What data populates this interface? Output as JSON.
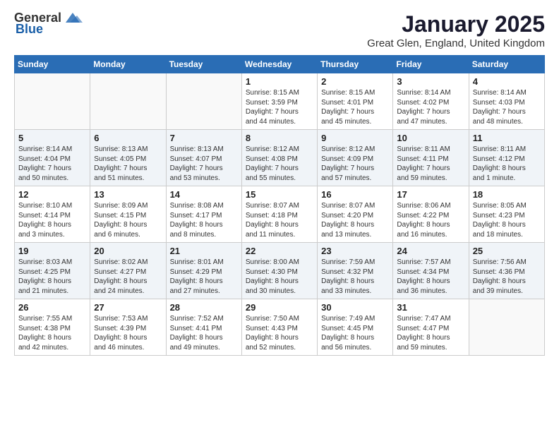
{
  "header": {
    "logo_general": "General",
    "logo_blue": "Blue",
    "title": "January 2025",
    "subtitle": "Great Glen, England, United Kingdom"
  },
  "weekdays": [
    "Sunday",
    "Monday",
    "Tuesday",
    "Wednesday",
    "Thursday",
    "Friday",
    "Saturday"
  ],
  "weeks": [
    [
      {
        "day": "",
        "info": ""
      },
      {
        "day": "",
        "info": ""
      },
      {
        "day": "",
        "info": ""
      },
      {
        "day": "1",
        "info": "Sunrise: 8:15 AM\nSunset: 3:59 PM\nDaylight: 7 hours\nand 44 minutes."
      },
      {
        "day": "2",
        "info": "Sunrise: 8:15 AM\nSunset: 4:01 PM\nDaylight: 7 hours\nand 45 minutes."
      },
      {
        "day": "3",
        "info": "Sunrise: 8:14 AM\nSunset: 4:02 PM\nDaylight: 7 hours\nand 47 minutes."
      },
      {
        "day": "4",
        "info": "Sunrise: 8:14 AM\nSunset: 4:03 PM\nDaylight: 7 hours\nand 48 minutes."
      }
    ],
    [
      {
        "day": "5",
        "info": "Sunrise: 8:14 AM\nSunset: 4:04 PM\nDaylight: 7 hours\nand 50 minutes."
      },
      {
        "day": "6",
        "info": "Sunrise: 8:13 AM\nSunset: 4:05 PM\nDaylight: 7 hours\nand 51 minutes."
      },
      {
        "day": "7",
        "info": "Sunrise: 8:13 AM\nSunset: 4:07 PM\nDaylight: 7 hours\nand 53 minutes."
      },
      {
        "day": "8",
        "info": "Sunrise: 8:12 AM\nSunset: 4:08 PM\nDaylight: 7 hours\nand 55 minutes."
      },
      {
        "day": "9",
        "info": "Sunrise: 8:12 AM\nSunset: 4:09 PM\nDaylight: 7 hours\nand 57 minutes."
      },
      {
        "day": "10",
        "info": "Sunrise: 8:11 AM\nSunset: 4:11 PM\nDaylight: 7 hours\nand 59 minutes."
      },
      {
        "day": "11",
        "info": "Sunrise: 8:11 AM\nSunset: 4:12 PM\nDaylight: 8 hours\nand 1 minute."
      }
    ],
    [
      {
        "day": "12",
        "info": "Sunrise: 8:10 AM\nSunset: 4:14 PM\nDaylight: 8 hours\nand 3 minutes."
      },
      {
        "day": "13",
        "info": "Sunrise: 8:09 AM\nSunset: 4:15 PM\nDaylight: 8 hours\nand 6 minutes."
      },
      {
        "day": "14",
        "info": "Sunrise: 8:08 AM\nSunset: 4:17 PM\nDaylight: 8 hours\nand 8 minutes."
      },
      {
        "day": "15",
        "info": "Sunrise: 8:07 AM\nSunset: 4:18 PM\nDaylight: 8 hours\nand 11 minutes."
      },
      {
        "day": "16",
        "info": "Sunrise: 8:07 AM\nSunset: 4:20 PM\nDaylight: 8 hours\nand 13 minutes."
      },
      {
        "day": "17",
        "info": "Sunrise: 8:06 AM\nSunset: 4:22 PM\nDaylight: 8 hours\nand 16 minutes."
      },
      {
        "day": "18",
        "info": "Sunrise: 8:05 AM\nSunset: 4:23 PM\nDaylight: 8 hours\nand 18 minutes."
      }
    ],
    [
      {
        "day": "19",
        "info": "Sunrise: 8:03 AM\nSunset: 4:25 PM\nDaylight: 8 hours\nand 21 minutes."
      },
      {
        "day": "20",
        "info": "Sunrise: 8:02 AM\nSunset: 4:27 PM\nDaylight: 8 hours\nand 24 minutes."
      },
      {
        "day": "21",
        "info": "Sunrise: 8:01 AM\nSunset: 4:29 PM\nDaylight: 8 hours\nand 27 minutes."
      },
      {
        "day": "22",
        "info": "Sunrise: 8:00 AM\nSunset: 4:30 PM\nDaylight: 8 hours\nand 30 minutes."
      },
      {
        "day": "23",
        "info": "Sunrise: 7:59 AM\nSunset: 4:32 PM\nDaylight: 8 hours\nand 33 minutes."
      },
      {
        "day": "24",
        "info": "Sunrise: 7:57 AM\nSunset: 4:34 PM\nDaylight: 8 hours\nand 36 minutes."
      },
      {
        "day": "25",
        "info": "Sunrise: 7:56 AM\nSunset: 4:36 PM\nDaylight: 8 hours\nand 39 minutes."
      }
    ],
    [
      {
        "day": "26",
        "info": "Sunrise: 7:55 AM\nSunset: 4:38 PM\nDaylight: 8 hours\nand 42 minutes."
      },
      {
        "day": "27",
        "info": "Sunrise: 7:53 AM\nSunset: 4:39 PM\nDaylight: 8 hours\nand 46 minutes."
      },
      {
        "day": "28",
        "info": "Sunrise: 7:52 AM\nSunset: 4:41 PM\nDaylight: 8 hours\nand 49 minutes."
      },
      {
        "day": "29",
        "info": "Sunrise: 7:50 AM\nSunset: 4:43 PM\nDaylight: 8 hours\nand 52 minutes."
      },
      {
        "day": "30",
        "info": "Sunrise: 7:49 AM\nSunset: 4:45 PM\nDaylight: 8 hours\nand 56 minutes."
      },
      {
        "day": "31",
        "info": "Sunrise: 7:47 AM\nSunset: 4:47 PM\nDaylight: 8 hours\nand 59 minutes."
      },
      {
        "day": "",
        "info": ""
      }
    ]
  ]
}
